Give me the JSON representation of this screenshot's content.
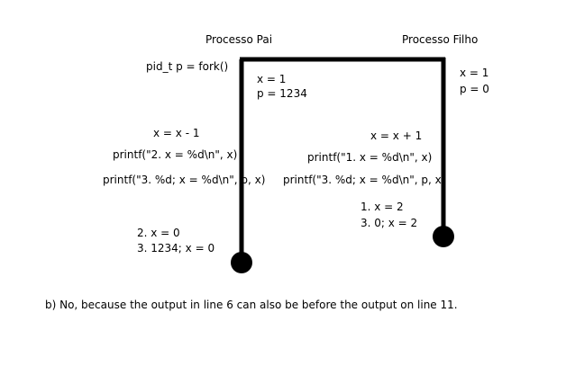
{
  "labels": {
    "parent_title": "Processo Pai",
    "child_title": "Processo Filho",
    "fork_call": "pid_t p = fork()"
  },
  "parent_state": {
    "x": "x = 1",
    "p": "p = 1234"
  },
  "child_state": {
    "x": "x = 1",
    "p": "p = 0"
  },
  "parent_code": [
    "x = x - 1",
    "printf(\"2. x = %d\\n\", x)",
    "printf(\"3. %d; x = %d\\n\", p, x)"
  ],
  "child_code": [
    "x = x + 1",
    "printf(\"1. x = %d\\n\", x)",
    "printf(\"3. %d; x = %d\\n\", p, x"
  ],
  "parent_output": [
    "2. x = 0",
    "3. 1234; x = 0"
  ],
  "child_output": [
    "1. x = 2",
    "3. 0; x = 2"
  ],
  "answer": "b) No, because the output in line 6 can also be before the output on line 11.",
  "colors": {
    "line": "#000000",
    "text": "#000000",
    "background": "#ffffff"
  }
}
